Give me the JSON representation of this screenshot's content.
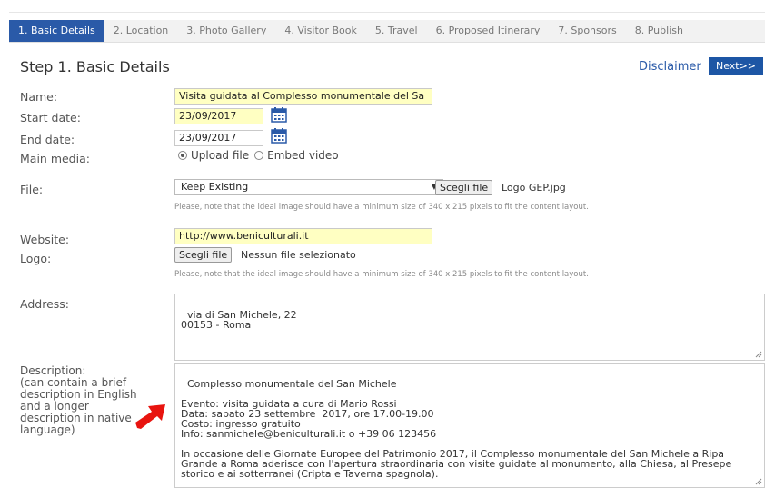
{
  "tabs": [
    {
      "label": "1. Basic Details",
      "active": true
    },
    {
      "label": "2. Location",
      "active": false
    },
    {
      "label": "3. Photo Gallery",
      "active": false
    },
    {
      "label": "4. Visitor Book",
      "active": false
    },
    {
      "label": "5. Travel",
      "active": false
    },
    {
      "label": "6. Proposed Itinerary",
      "active": false
    },
    {
      "label": "7. Sponsors",
      "active": false
    },
    {
      "label": "8. Publish",
      "active": false
    }
  ],
  "header": {
    "title": "Step 1. Basic Details",
    "disclaimer": "Disclaimer",
    "next": "Next>>"
  },
  "form": {
    "name": {
      "label": "Name:",
      "value": "Visita guidata al Complesso monumentale del Sa"
    },
    "start_date": {
      "label": "Start date:",
      "value": "23/09/2017"
    },
    "end_date": {
      "label": "End date:",
      "value": "23/09/2017"
    },
    "main_media": {
      "label": "Main media:",
      "option_upload": "Upload file",
      "option_embed": "Embed video"
    },
    "file": {
      "label": "File:",
      "select_value": "Keep Existing",
      "button": "Scegli file",
      "filename": "Logo GEP.jpg",
      "note": "Please, note that the ideal image should have a minimum size of 340 x 215 pixels to fit the content layout."
    },
    "website": {
      "label": "Website:",
      "value": "http://www.beniculturali.it"
    },
    "logo": {
      "label": "Logo:",
      "button": "Scegli file",
      "status": "Nessun file selezionato",
      "note": "Please, note that the ideal image should have a minimum size of 340 x 215 pixels to fit the content layout."
    },
    "address": {
      "label": "Address:",
      "value": "via di San Michele, 22\n00153 - Roma"
    },
    "description": {
      "label": "Description:\n(can contain a brief description in English and a longer description in native language)",
      "value": "Complesso monumentale del San Michele\n\nEvento: visita guidata a cura di Mario Rossi\nData: sabato 23 settembre  2017, ore 17.00-19.00\nCosto: ingresso gratuito\nInfo: sanmichele@beniculturali.it o +39 06 123456\n\nIn occasione delle Giornate Europee del Patrimonio 2017, il Complesso monumentale del San Michele a Ripa Grande a Roma aderisce con l'apertura straordinaria con visite guidate al monumento, alla Chiesa, al Presepe storico e ai sotterranei (Cripta e Taverna spagnola)."
    }
  },
  "colors": {
    "accent": "#2a5aa8",
    "next_button": "#1d56a5",
    "input_highlight": "#ffffc2",
    "pointer_arrow": "#e8140f"
  },
  "icons": {
    "calendar": "calendar-icon",
    "pointer": "red-arrow-icon"
  }
}
